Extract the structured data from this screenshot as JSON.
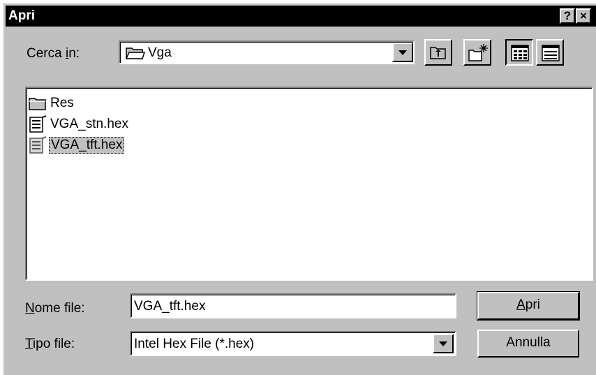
{
  "window": {
    "title": "Apri",
    "help_button": "?",
    "close_button": "×"
  },
  "lookin": {
    "label_prefix": "Cerca ",
    "label_mnemonic": "i",
    "label_suffix": "n:",
    "value": "Vga",
    "folder_icon": "open-folder-icon"
  },
  "toolbar": {
    "icons": [
      "up-one-level-icon",
      "new-folder-icon",
      "list-view-icon",
      "details-view-icon"
    ]
  },
  "files": [
    {
      "name": "Res",
      "icon": "folder-icon",
      "selected": false
    },
    {
      "name": "VGA_stn.hex",
      "icon": "hex-file-icon",
      "selected": false
    },
    {
      "name": "VGA_tft.hex",
      "icon": "hex-file-icon",
      "selected": true
    }
  ],
  "filename": {
    "label_mnemonic": "N",
    "label_rest": "ome file:",
    "value": "VGA_tft.hex"
  },
  "filetype": {
    "label_mnemonic": "T",
    "label_rest": "ipo file:",
    "value": "Intel Hex File (*.hex)"
  },
  "buttons": {
    "open_mnemonic": "A",
    "open_rest": "pri",
    "cancel": "Annulla"
  },
  "colors": {
    "face": "#c0c0c0",
    "title_bar": "#000000",
    "list_bg": "#ffffff"
  }
}
